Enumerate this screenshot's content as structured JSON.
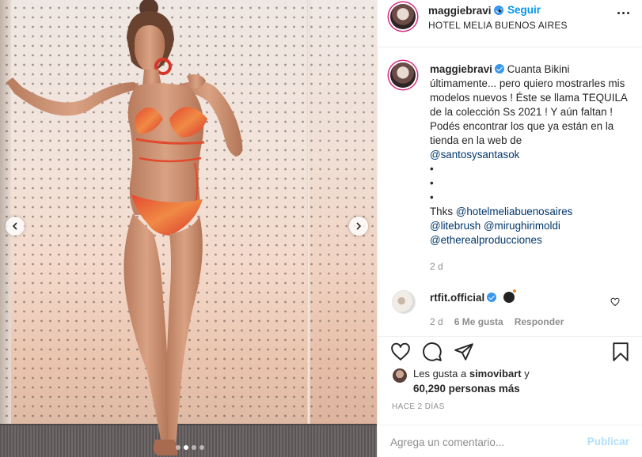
{
  "post": {
    "username": "maggiebravi",
    "separator": "•",
    "follow_label": "Seguir",
    "location": "HOTEL MELIA BUENOS AIRES"
  },
  "caption": {
    "username": "maggiebravi",
    "text": "Cuanta Bikini últimamente... pero quiero mostrarles mis modelos nuevos ! Éste se llama TEQUILA de la colección Ss 2021 ! Y aún faltan ! Podés encontrar los que ya están en la tienda en la web de",
    "mention1": "@santosysantasok",
    "bullets": [
      "•",
      "•",
      "•"
    ],
    "thanks_prefix": "Thks",
    "mention2": "@hotelmeliabuenosaires",
    "mention3": "@litebrush",
    "mention4": "@mirughirimoldi",
    "mention5": "@etherealproducciones",
    "time": "2 d"
  },
  "comment": {
    "username": "rtfit.official",
    "time": "2 d",
    "likes": "6 Me gusta",
    "reply": "Responder"
  },
  "likes_line": {
    "prefix": "Les gusta a",
    "user": "simovibart",
    "conj": "y",
    "others": "60,290 personas más"
  },
  "timestamp": "HACE 2 DÍAS",
  "composer": {
    "placeholder": "Agrega un comentario...",
    "publish": "Publicar"
  },
  "carousel": {
    "current": 2,
    "total": 4
  },
  "icons": [
    "heart-icon",
    "comment-icon",
    "share-icon",
    "bookmark-icon",
    "chevron-left-icon",
    "chevron-right-icon",
    "more-icon",
    "verified-icon"
  ],
  "colors": {
    "accent": "#0095f6",
    "mention": "#00376b",
    "muted": "#8e8e8e",
    "publish_disabled": "#b2dffc"
  }
}
